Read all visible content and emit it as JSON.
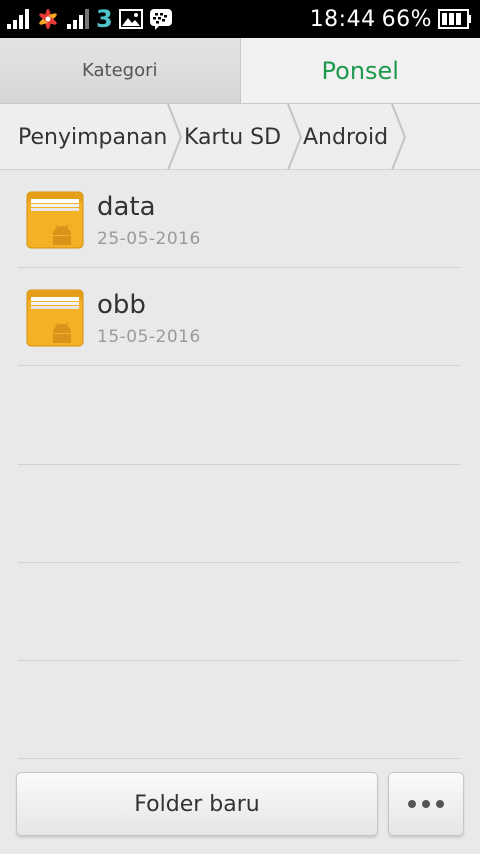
{
  "status_bar": {
    "carrier": "3",
    "time": "18:44",
    "battery": "66%",
    "icons": [
      "signal-icon",
      "pinwheel-app-icon",
      "signal-2-icon",
      "carrier-3-icon",
      "image-icon",
      "bbm-icon",
      "battery-icon"
    ]
  },
  "tabs": [
    {
      "label": "Kategori",
      "active": false
    },
    {
      "label": "Ponsel",
      "active": true
    }
  ],
  "breadcrumb": [
    "Penyimpanan",
    "Kartu SD",
    "Android"
  ],
  "files": [
    {
      "name": "data",
      "date": "25-05-2016",
      "icon": "android-folder-icon"
    },
    {
      "name": "obb",
      "date": "15-05-2016",
      "icon": "android-folder-icon"
    }
  ],
  "actions": {
    "new_folder": "Folder baru",
    "more_icon": "more-icon"
  },
  "colors": {
    "accent": "#1d9a4d",
    "folder": "#f5b126"
  }
}
